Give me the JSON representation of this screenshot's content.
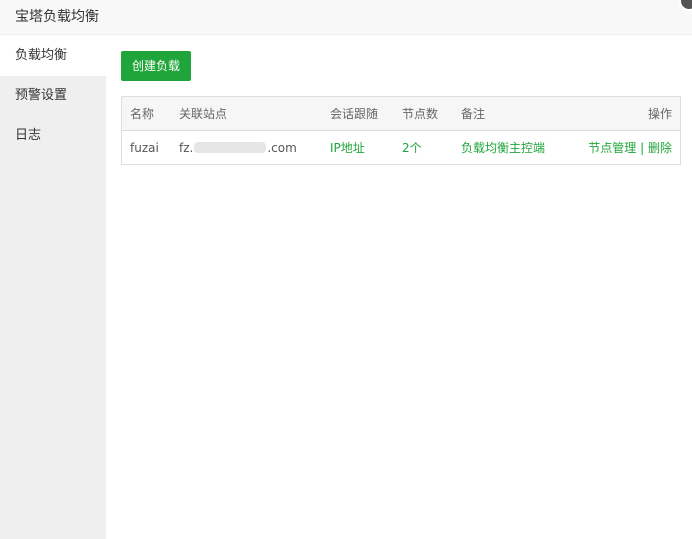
{
  "window": {
    "title": "宝塔负载均衡"
  },
  "sidebar": {
    "items": [
      {
        "label": "负载均衡",
        "active": true
      },
      {
        "label": "预警设置",
        "active": false
      },
      {
        "label": "日志",
        "active": false
      }
    ]
  },
  "toolbar": {
    "create_label": "创建负载"
  },
  "table": {
    "headers": {
      "name": "名称",
      "site": "关联站点",
      "session": "会话跟随",
      "nodes": "节点数",
      "remark": "备注",
      "actions": "操作"
    },
    "rows": [
      {
        "name": "fuzai",
        "site_prefix": "fz.",
        "site_suffix": ".com",
        "session": "IP地址",
        "nodes": "2个",
        "remark": "负载均衡主控端",
        "action_manage": "节点管理",
        "action_separator": "|",
        "action_delete": "删除"
      }
    ]
  },
  "colors": {
    "accent": "#20a53a",
    "sidebar_bg": "#efefef",
    "header_bg": "#f6f6f6"
  }
}
